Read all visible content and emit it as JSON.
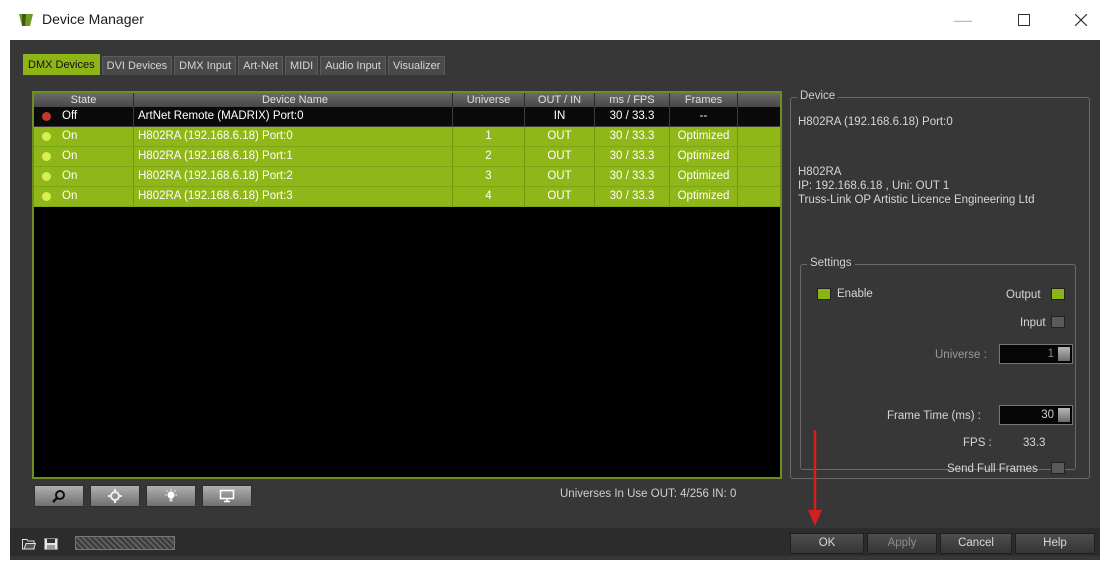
{
  "window": {
    "title": "Device Manager"
  },
  "tabs": [
    "DMX Devices",
    "DVI Devices",
    "DMX Input",
    "Art-Net",
    "MIDI",
    "Audio Input",
    "Visualizer"
  ],
  "table": {
    "headers": [
      "State",
      "Device Name",
      "Universe",
      "OUT / IN",
      "ms / FPS",
      "Frames"
    ],
    "rows": [
      {
        "state": "Off",
        "name": "ArtNet Remote (MADRIX) Port:0",
        "universe": "",
        "outin": "IN",
        "msfps": "30 / 33.3",
        "frames": "--"
      },
      {
        "state": "On",
        "name": "H802RA (192.168.6.18) Port:0",
        "universe": "1",
        "outin": "OUT",
        "msfps": "30 / 33.3",
        "frames": "Optimized"
      },
      {
        "state": "On",
        "name": "H802RA (192.168.6.18) Port:1",
        "universe": "2",
        "outin": "OUT",
        "msfps": "30 / 33.3",
        "frames": "Optimized"
      },
      {
        "state": "On",
        "name": "H802RA (192.168.6.18) Port:2",
        "universe": "3",
        "outin": "OUT",
        "msfps": "30 / 33.3",
        "frames": "Optimized"
      },
      {
        "state": "On",
        "name": "H802RA (192.168.6.18) Port:3",
        "universe": "4",
        "outin": "OUT",
        "msfps": "30 / 33.3",
        "frames": "Optimized"
      }
    ]
  },
  "status": {
    "universes": "Universes In Use OUT: 4/256  IN: 0"
  },
  "device": {
    "legend": "Device",
    "selected": "H802RA (192.168.6.18) Port:0",
    "model": "H802RA",
    "ip_line": "IP: 192.168.6.18 , Uni: OUT 1",
    "vendor": "Truss-Link OP Artistic Licence Engineering Ltd"
  },
  "settings": {
    "legend": "Settings",
    "enable_label": "Enable",
    "output_label": "Output",
    "input_label": "Input",
    "universe_label": "Universe :",
    "universe_value": "1",
    "frame_time_label": "Frame Time (ms) :",
    "frame_time_value": "30",
    "fps_label": "FPS :",
    "fps_value": "33.3",
    "send_full_label": "Send Full Frames"
  },
  "footer": {
    "ok": "OK",
    "apply": "Apply",
    "cancel": "Cancel",
    "help": "Help"
  },
  "colors": {
    "accent": "#8fb718",
    "led_on": "#c9e64a",
    "led_off": "#c0392b"
  },
  "icons": [
    "search-icon",
    "settings-gear-icon",
    "light-bulb-icon",
    "monitor-icon",
    "open-folder-icon",
    "save-disk-icon"
  ]
}
